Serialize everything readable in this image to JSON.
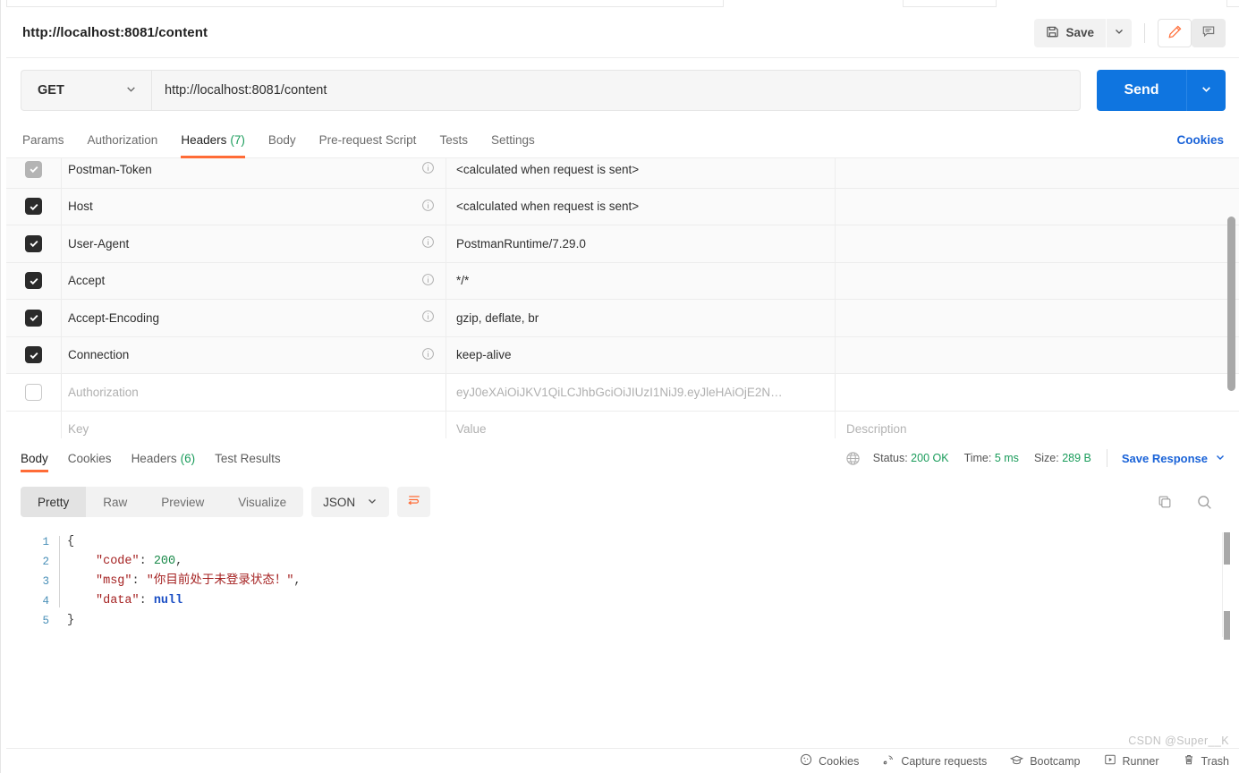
{
  "request": {
    "title": "http://localhost:8081/content",
    "method": "GET",
    "url": "http://localhost:8081/content",
    "send_label": "Send",
    "save_label": "Save",
    "tabs": [
      {
        "label": "Params",
        "count": "",
        "active": false
      },
      {
        "label": "Authorization",
        "count": "",
        "active": false
      },
      {
        "label": "Headers",
        "count": "(7)",
        "active": true
      },
      {
        "label": "Body",
        "count": "",
        "active": false
      },
      {
        "label": "Pre-request Script",
        "count": "",
        "active": false
      },
      {
        "label": "Tests",
        "count": "",
        "active": false
      },
      {
        "label": "Settings",
        "count": "",
        "active": false
      }
    ],
    "cookies_link": "Cookies"
  },
  "headers_table": {
    "columns": [
      "Key",
      "Value",
      "Description"
    ],
    "placeholders": {
      "key": "Key",
      "value": "Value",
      "description": "Description"
    },
    "rows": [
      {
        "key": "Postman-Token",
        "value": "<calculated when request is sent>",
        "checked": true,
        "disabled": true,
        "info": true
      },
      {
        "key": "Host",
        "value": "<calculated when request is sent>",
        "checked": true,
        "disabled": false,
        "info": true
      },
      {
        "key": "User-Agent",
        "value": "PostmanRuntime/7.29.0",
        "checked": true,
        "disabled": false,
        "info": true
      },
      {
        "key": "Accept",
        "value": "*/*",
        "checked": true,
        "disabled": false,
        "info": true
      },
      {
        "key": "Accept-Encoding",
        "value": "gzip, deflate, br",
        "checked": true,
        "disabled": false,
        "info": true
      },
      {
        "key": "Connection",
        "value": "keep-alive",
        "checked": true,
        "disabled": false,
        "info": true
      },
      {
        "key": "Authorization",
        "value": "eyJ0eXAiOiJKV1QiLCJhbGciOiJIUzI1NiJ9.eyJleHAiOjE2N…",
        "checked": false,
        "disabled": false,
        "info": false
      }
    ]
  },
  "response": {
    "tabs": [
      {
        "label": "Body",
        "count": "",
        "active": true
      },
      {
        "label": "Cookies",
        "count": "",
        "active": false
      },
      {
        "label": "Headers",
        "count": "(6)",
        "active": false
      },
      {
        "label": "Test Results",
        "count": "",
        "active": false
      }
    ],
    "status_label": "Status:",
    "status_value": "200 OK",
    "time_label": "Time:",
    "time_value": "5 ms",
    "size_label": "Size:",
    "size_value": "289 B",
    "save_response": "Save Response",
    "view_modes": [
      "Pretty",
      "Raw",
      "Preview",
      "Visualize"
    ],
    "view_mode_active": "Pretty",
    "format": "JSON",
    "line_numbers": [
      "1",
      "2",
      "3",
      "4",
      "5"
    ],
    "body_lines": [
      {
        "indent": 0,
        "parts": [
          {
            "t": "{",
            "c": "brace"
          }
        ]
      },
      {
        "indent": 1,
        "parts": [
          {
            "t": "\"code\"",
            "c": "key"
          },
          {
            "t": ": ",
            "c": "punc"
          },
          {
            "t": "200",
            "c": "num"
          },
          {
            "t": ",",
            "c": "punc"
          }
        ]
      },
      {
        "indent": 1,
        "parts": [
          {
            "t": "\"msg\"",
            "c": "key"
          },
          {
            "t": ": ",
            "c": "punc"
          },
          {
            "t": "\"你目前处于未登录状态！\"",
            "c": "str"
          },
          {
            "t": ",",
            "c": "punc"
          }
        ]
      },
      {
        "indent": 1,
        "parts": [
          {
            "t": "\"data\"",
            "c": "key"
          },
          {
            "t": ": ",
            "c": "punc"
          },
          {
            "t": "null",
            "c": "null"
          }
        ]
      },
      {
        "indent": 0,
        "parts": [
          {
            "t": "}",
            "c": "brace"
          }
        ]
      }
    ]
  },
  "statusbar": {
    "items": [
      {
        "label": "Cookies",
        "icon": "cookie-icon"
      },
      {
        "label": "Capture requests",
        "icon": "satellite-icon"
      },
      {
        "label": "Bootcamp",
        "icon": "graduation-cap-icon"
      },
      {
        "label": "Runner",
        "icon": "play-icon"
      },
      {
        "label": "Trash",
        "icon": "trash-icon"
      }
    ],
    "watermark": "CSDN @Super__K"
  },
  "colors": {
    "accent": "#ff6c37",
    "send_blue": "#0f75e0",
    "link_blue": "#1a63d8",
    "status_green": "#1a9c5b"
  }
}
